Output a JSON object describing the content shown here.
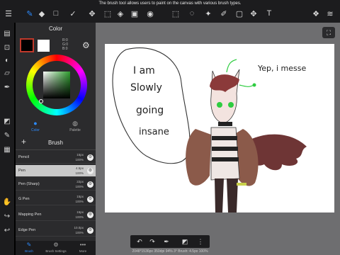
{
  "tooltip": "The brush tool allows users to paint on the canvas with various brush types.",
  "toolbar": {
    "tools": [
      {
        "name": "menu-icon",
        "glyph": "☰"
      },
      {
        "name": "brush-tool-icon",
        "glyph": "✎"
      },
      {
        "name": "eraser-tool-icon",
        "glyph": "◆"
      },
      {
        "name": "rect-tool-icon",
        "glyph": "□"
      },
      {
        "name": "check-tool-icon",
        "glyph": "✓"
      },
      {
        "name": "move-tool-icon",
        "glyph": "✥"
      },
      {
        "name": "transform-tool-icon",
        "glyph": "⬚"
      },
      {
        "name": "fill-tool-icon",
        "glyph": "◈"
      },
      {
        "name": "gradient-tool-icon",
        "glyph": "▣"
      },
      {
        "name": "blur-tool-icon",
        "glyph": "◉"
      },
      {
        "name": "select-tool-icon",
        "glyph": "⬚"
      },
      {
        "name": "lasso-tool-icon",
        "glyph": "◌"
      },
      {
        "name": "magic-wand-icon",
        "glyph": "✦"
      },
      {
        "name": "select-pen-icon",
        "glyph": "✐"
      },
      {
        "name": "select-eraser-icon",
        "glyph": "▢"
      },
      {
        "name": "text-tool-icon",
        "glyph": "T"
      },
      {
        "name": "materials-icon",
        "glyph": "❖"
      },
      {
        "name": "layers-icon",
        "glyph": "≋"
      }
    ]
  },
  "color_panel": {
    "title": "Color",
    "r": "R:0",
    "g": "G:0",
    "b": "B:0",
    "tabs": [
      {
        "label": "Color",
        "icon": "●"
      },
      {
        "label": "Palette",
        "icon": "◍"
      }
    ]
  },
  "brush_panel": {
    "title": "Brush",
    "brushes": [
      {
        "name": "Pencil",
        "size": "15px",
        "opacity": "100%"
      },
      {
        "name": "Pen",
        "size": "4.5px",
        "opacity": "100%"
      },
      {
        "name": "Pen (Sharp)",
        "size": "22px",
        "opacity": "100%"
      },
      {
        "name": "G Pen",
        "size": "15px",
        "opacity": "100%"
      },
      {
        "name": "Mapping Pen",
        "size": "15px",
        "opacity": "100%"
      },
      {
        "name": "Edge Pen",
        "size": "10.0px",
        "opacity": "100%"
      }
    ]
  },
  "bottom_tabs": [
    {
      "label": "Brush",
      "icon": "✎"
    },
    {
      "label": "Brush Settings",
      "icon": "⚙"
    },
    {
      "label": "More",
      "icon": "•••"
    }
  ],
  "status": "2048*1536px 350dpi 94% 3° Brush: 4.5px 100%",
  "canvas_text": {
    "bubble_line1": "I am",
    "bubble_line2": "Slowly",
    "bubble_line3": "going",
    "bubble_line4": "insane",
    "side_note": "Yep, i messe"
  },
  "colors": {
    "accent": "#2d8cff",
    "panel": "#2b2b2d",
    "toolbar": "#1c1c1e",
    "canvas_bg": "#6e6e70"
  }
}
